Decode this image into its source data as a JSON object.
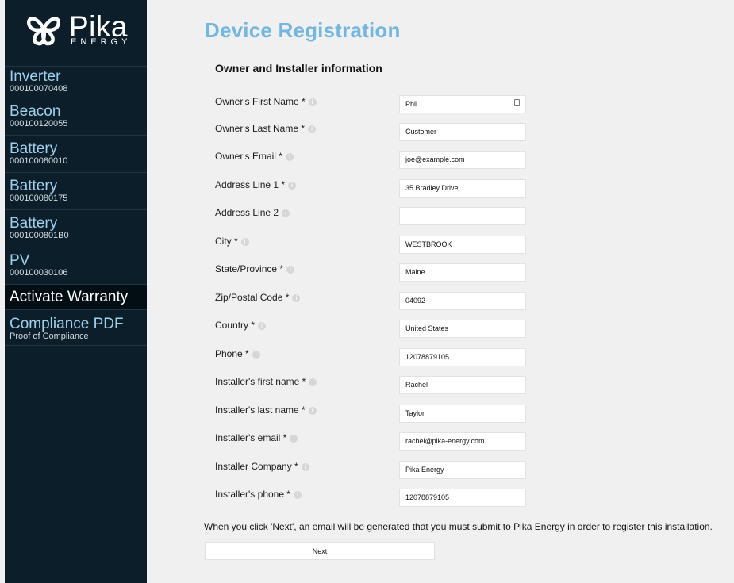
{
  "brand": {
    "name": "Pika",
    "tagline": "ENERGY",
    "logo_icon": "pika-logo-icon"
  },
  "sidebar": {
    "items": [
      {
        "label": "Inverter",
        "sub": "000100070408"
      },
      {
        "label": "Beacon",
        "sub": "000100120055"
      },
      {
        "label": "Battery",
        "sub": "000100080010"
      },
      {
        "label": "Battery",
        "sub": "000100080175"
      },
      {
        "label": "Battery",
        "sub": "0001000801B0"
      },
      {
        "label": "PV",
        "sub": "000100030106"
      },
      {
        "label": "Activate Warranty",
        "sub": "",
        "active": true
      },
      {
        "label": "Compliance PDF",
        "sub": "Proof of Compliance"
      }
    ]
  },
  "page": {
    "title": "Device Registration",
    "section_title": "Owner and Installer information"
  },
  "form": {
    "fields": [
      {
        "label": "Owner's First Name *",
        "value": "Phil"
      },
      {
        "label": "Owner's Last Name *",
        "value": "Customer"
      },
      {
        "label": "Owner's Email *",
        "value": "joe@example.com"
      },
      {
        "label": "Address Line 1 *",
        "value": "35 Bradley Drive"
      },
      {
        "label": "Address Line 2",
        "value": ""
      },
      {
        "label": "City *",
        "value": "WESTBROOK"
      },
      {
        "label": "State/Province *",
        "value": "Maine"
      },
      {
        "label": "Zip/Postal Code *",
        "value": "04092"
      },
      {
        "label": "Country *",
        "value": "United States"
      },
      {
        "label": "Phone *",
        "value": "12078879105"
      },
      {
        "label": "Installer's first name *",
        "value": "Rachel"
      },
      {
        "label": "Installer's last name *",
        "value": "Taylor"
      },
      {
        "label": "Installer's email *",
        "value": "rachel@pika-energy.com"
      },
      {
        "label": "Installer Company *",
        "value": "Pika Energy"
      },
      {
        "label": "Installer's phone *",
        "value": "12078879105"
      }
    ],
    "info_icon": "i",
    "notice": "When you click 'Next', an email will be generated that you must submit to Pika Energy in order to register this installation.",
    "next_label": "Next"
  },
  "colors": {
    "sidebar_bg": "#0d1e2b",
    "accent": "#73b6e0",
    "nav_text": "#9fd0ec"
  }
}
